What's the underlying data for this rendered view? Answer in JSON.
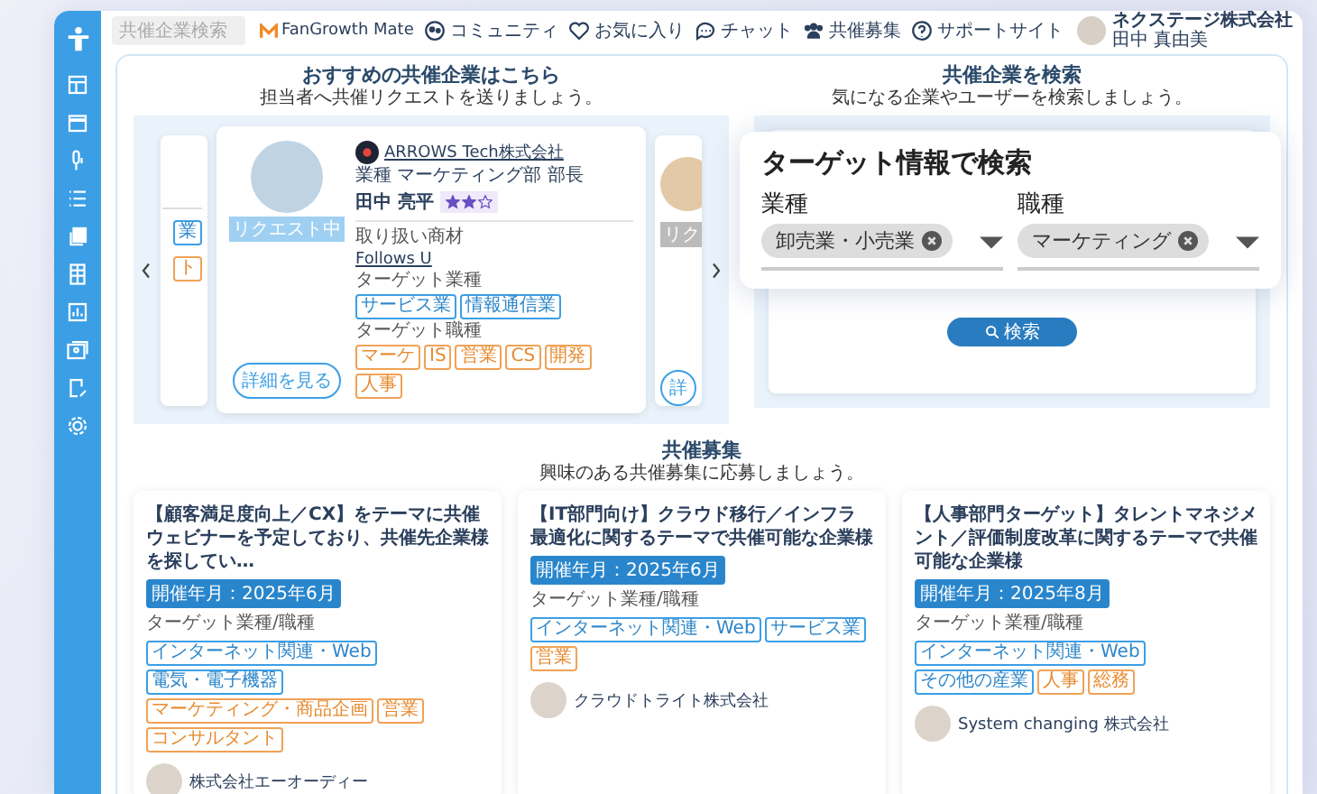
{
  "header": {
    "search": {
      "placeholder": "共催企業検索"
    },
    "brand": "FanGrowth Mate",
    "nav": [
      {
        "label": "コミュニティ",
        "kind": "community"
      },
      {
        "label": "お気に入り",
        "kind": "favorite"
      },
      {
        "label": "チャット",
        "kind": "chat"
      },
      {
        "label": "共催募集",
        "kind": "group"
      },
      {
        "label": "サポートサイト",
        "kind": "help"
      }
    ],
    "user": {
      "company": "ネクステージ株式会社",
      "name": "田中 真由美"
    }
  },
  "recommend": {
    "title": "おすすめの共催企業はこちら",
    "subtitle": "担当者へ共催リクエストを送りましょう。",
    "prev_card": {
      "tags": [
        {
          "label": "業",
          "kind": "industry"
        },
        {
          "label": "ト",
          "kind": "role"
        }
      ]
    },
    "card": {
      "badge": "リクエスト中",
      "company": "ARROWS Tech株式会社",
      "role_label": "業種",
      "role": "マーケティング部 部長",
      "name": "田中 亮平",
      "stars": 2,
      "product_label": "取り扱い商材",
      "product": "Follows U",
      "industry_label": "ターゲット業種",
      "industries": [
        "サービス業",
        "情報通信業"
      ],
      "job_label": "ターゲット職種",
      "jobs": [
        "マーケ",
        "IS",
        "営業",
        "CS",
        "開発",
        "人事"
      ],
      "button": "詳細を見る"
    },
    "next_card": {
      "badge": "リク",
      "button": "詳"
    }
  },
  "search": {
    "title": "共催企業を検索",
    "subtitle": "気になる企業やユーザーを検索しましょう。",
    "button": "検索",
    "popup": {
      "title": "ターゲット情報で検索",
      "fields": [
        {
          "label": "業種",
          "chip": "卸売業・小売業"
        },
        {
          "label": "職種",
          "chip": "マーケティング"
        }
      ]
    }
  },
  "recruit": {
    "title": "共催募集",
    "subtitle": "興味のある共催募集に応募しましょう。",
    "cards": [
      {
        "title": "【顧客満足度向上／CX】をテーマに共催ウェビナーを予定しており、共催先企業様を探してい…",
        "date": "開催年月：2025年6月",
        "label": "ターゲット業種/職種",
        "tags": [
          {
            "label": "インターネット関連・Web",
            "kind": "industry"
          },
          {
            "label": "電気・電子機器",
            "kind": "industry"
          },
          {
            "label": "マーケティング・商品企画",
            "kind": "role"
          },
          {
            "label": "営業",
            "kind": "role"
          },
          {
            "label": "コンサルタント",
            "kind": "role"
          }
        ],
        "company": "株式会社エーオーディー"
      },
      {
        "title": "【IT部門向け】クラウド移行／インフラ最適化に関するテーマで共催可能な企業様",
        "date": "開催年月：2025年6月",
        "label": "ターゲット業種/職種",
        "tags": [
          {
            "label": "インターネット関連・Web",
            "kind": "industry"
          },
          {
            "label": "サービス業",
            "kind": "industry"
          },
          {
            "label": "営業",
            "kind": "role"
          }
        ],
        "company": "クラウドトライト株式会社"
      },
      {
        "title": "【人事部門ターゲット】タレントマネジメント／評価制度改革に関するテーマで共催可能な企業様",
        "date": "開催年月：2025年8月",
        "label": "ターゲット業種/職種",
        "tags": [
          {
            "label": "インターネット関連・Web",
            "kind": "industry"
          },
          {
            "label": "その他の産業",
            "kind": "industry"
          },
          {
            "label": "人事",
            "kind": "role"
          },
          {
            "label": "総務",
            "kind": "role"
          }
        ],
        "company": "System changing 株式会社"
      }
    ]
  }
}
